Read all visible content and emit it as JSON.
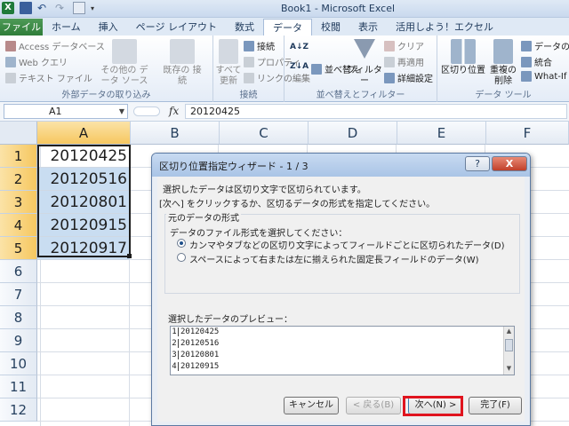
{
  "window": {
    "title": "Book1 - Microsoft Excel"
  },
  "tabs": [
    {
      "label": "ファイル"
    },
    {
      "label": "ホーム"
    },
    {
      "label": "挿入"
    },
    {
      "label": "ページ レイアウト"
    },
    {
      "label": "数式"
    },
    {
      "label": "データ"
    },
    {
      "label": "校閲"
    },
    {
      "label": "表示"
    },
    {
      "label": "活用しよう！エクセル"
    }
  ],
  "ribbon": {
    "ext_group": {
      "label": "外部データの取り込み",
      "access": "Access データベース",
      "web": "Web クエリ",
      "text": "テキスト ファイル",
      "other": "その他の データ ソース",
      "existing": "既存の 接続"
    },
    "conn_group": {
      "label": "接続",
      "refresh": "すべて 更新",
      "connections": "接続",
      "properties": "プロパティ",
      "edit_links": "リンクの編集"
    },
    "sort_group": {
      "label": "並べ替えとフィルター",
      "sort": "並べ替え",
      "filter": "フィルター",
      "clear": "クリア",
      "reapply": "再適用",
      "advanced": "詳細設定"
    },
    "tools_group": {
      "label": "データ ツール",
      "text_to_columns": "区切り位置",
      "remove_duplicates": "重複の 削除",
      "validation": "データの入",
      "consolidate": "統合",
      "whatif": "What-If"
    }
  },
  "formula_bar": {
    "name_box": "A1",
    "fx": "fx",
    "value": "20120425"
  },
  "grid": {
    "columns": [
      "A",
      "B",
      "C",
      "D",
      "E",
      "F"
    ],
    "rows": [
      "1",
      "2",
      "3",
      "4",
      "5",
      "6",
      "7",
      "8",
      "9",
      "10",
      "11",
      "12"
    ],
    "cells_a": [
      "20120425",
      "20120516",
      "20120801",
      "20120915",
      "20120917"
    ]
  },
  "dialog": {
    "title": "区切り位置指定ウィザード - 1 / 3",
    "help": "?",
    "close": "X",
    "line1": "選択したデータは区切り文字で区切られています。",
    "line2": "[次へ] をクリックするか、区切るデータの形式を指定してください。",
    "frame_label": "元のデータの形式",
    "choose_label": "データのファイル形式を選択してください：",
    "option_delimited": "カンマやタブなどの区切り文字によってフィールドごとに区切られたデータ(D)",
    "option_fixed": "スペースによって右または左に揃えられた固定長フィールドのデータ(W)",
    "preview_label": "選択したデータのプレビュー：",
    "preview_lines": [
      {
        "num": "1",
        "text": "20120425"
      },
      {
        "num": "2",
        "text": "20120516"
      },
      {
        "num": "3",
        "text": "20120801"
      },
      {
        "num": "4",
        "text": "20120915"
      }
    ],
    "buttons": {
      "cancel": "キャンセル",
      "back": "< 戻る(B)",
      "next": "次へ(N) >",
      "finish": "完了(F)"
    }
  },
  "colors": {
    "file_tab": "#2f7d39",
    "selection_fill": "#c9ddf1",
    "highlight_box": "#e0141e"
  }
}
